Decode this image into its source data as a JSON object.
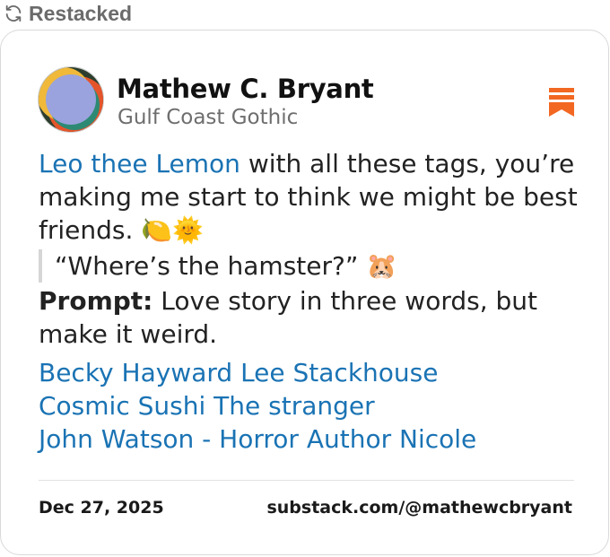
{
  "header": {
    "restacked_label": "Restacked",
    "restack_icon": "refresh-icon"
  },
  "card": {
    "author": {
      "name": "Mathew C. Bryant",
      "publication": "Gulf Coast Gothic",
      "avatar_icon": "avatar"
    },
    "bookmark_icon": "bookmark-icon",
    "accent_color": "#f26722",
    "link_color": "#1a73b4",
    "body": {
      "mention": "Leo thee Lemon",
      "text": " with all these tags, you’re making me start to think we might be best friends. ",
      "emojis": "🍋🌞",
      "quote": "“Where’s the hamster?” ",
      "quote_emoji": "🐹",
      "prompt_label": "Prompt:",
      "prompt_text": " Love story in three words, but make it weird."
    },
    "tags": [
      "Becky Hayward",
      "Lee Stackhouse",
      "Cosmic Sushi",
      "The stranger",
      "John Watson - Horror Author",
      "Nicole"
    ],
    "footer": {
      "date": "Dec 27, 2025",
      "url": "substack.com/@mathewcbryant"
    }
  }
}
